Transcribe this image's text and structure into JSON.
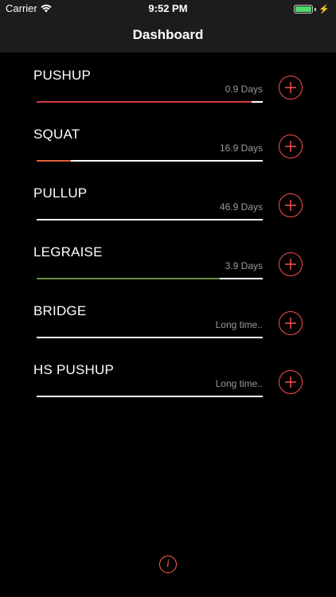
{
  "status_bar": {
    "carrier": "Carrier",
    "time": "9:52 PM",
    "battery_icon": "battery-charging-icon",
    "wifi_icon": "wifi-icon"
  },
  "nav": {
    "title": "Dashboard"
  },
  "exercises": [
    {
      "name": "PUSHUP",
      "days": "0.9 Days",
      "progress": 0.95,
      "color": "#d63a3a"
    },
    {
      "name": "SQUAT",
      "days": "16.9 Days",
      "progress": 0.15,
      "color": "#e0603a"
    },
    {
      "name": "PULLUP",
      "days": "46.9 Days",
      "progress": 0.0,
      "color": "#ffffff"
    },
    {
      "name": "LEGRAISE",
      "days": "3.9 Days",
      "progress": 0.81,
      "color": "#6e8a4a"
    },
    {
      "name": "BRIDGE",
      "days": "Long time..",
      "progress": 0.0,
      "color": "#ffffff"
    },
    {
      "name": "HS PUSHUP",
      "days": "Long time..",
      "progress": 0.0,
      "color": "#ffffff"
    }
  ],
  "add_icon": "plus-circle-icon",
  "accent": "#ff4e4e",
  "info": {
    "icon": "info-icon",
    "glyph": "i",
    "color": "#ff6a3d"
  }
}
